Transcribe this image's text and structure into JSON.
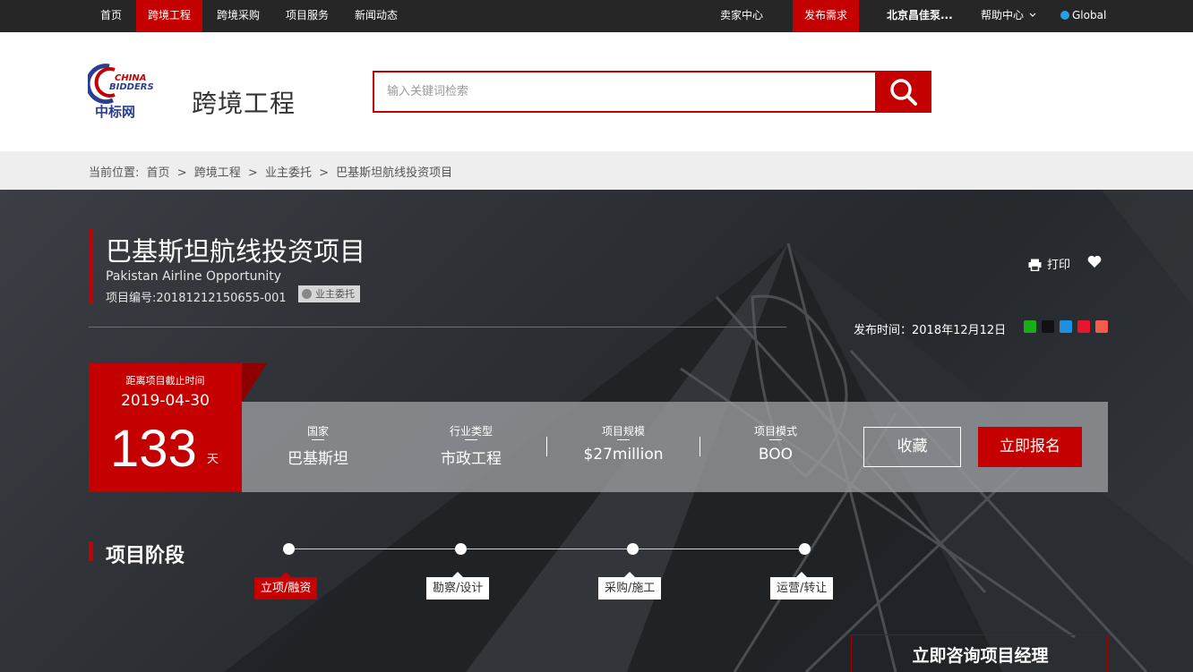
{
  "topnav": {
    "left": [
      "首页",
      "跨境工程",
      "跨境采购",
      "项目服务",
      "新闻动态"
    ],
    "seller_center": "卖家中心",
    "publish": "发布需求",
    "user": "北京昌佳泵...",
    "help": "帮助中心",
    "global": "Global"
  },
  "header": {
    "logo_text_en_1": "CHINA",
    "logo_text_en_2": "BIDDERS",
    "logo_text_cn": "中标网",
    "section_title": "跨境工程",
    "search_placeholder": "输入关键词检索"
  },
  "breadcrumb": {
    "prefix": "当前位置:",
    "items": [
      "首页",
      "跨境工程",
      "业主委托",
      "巴基斯坦航线投资项目"
    ],
    "sep": ">"
  },
  "project": {
    "title": "巴基斯坦航线投资项目",
    "subtitle": "Pakistan Airline Opportunity",
    "code": "项目编号:20181212150655-001",
    "tag": "业主委托",
    "print": "打印",
    "publish_date": "发布时间：2018年12月12日"
  },
  "countdown": {
    "label": "距离项目截止时间",
    "date": "2019-04-30",
    "days": "133",
    "unit": "天"
  },
  "fields": [
    {
      "key": "国家",
      "value": "巴基斯坦"
    },
    {
      "key": "行业类型",
      "value": "市政工程"
    },
    {
      "key": "项目规模",
      "value": "$27million"
    },
    {
      "key": "项目模式",
      "value": "BOO"
    }
  ],
  "actions": {
    "favorite": "收藏",
    "apply": "立即报名"
  },
  "stages": {
    "title": "项目阶段",
    "items": [
      "立项/融资",
      "勘察/设计",
      "采购/施工",
      "运营/转让"
    ],
    "active_index": 0
  },
  "consult": "立即咨询项目经理",
  "colors": {
    "brand_red": "#c40000",
    "topbar": "#262626"
  },
  "share_icons": [
    "wechat-icon",
    "qq-icon",
    "qzone-icon",
    "weibo-icon",
    "more-share-icon"
  ]
}
